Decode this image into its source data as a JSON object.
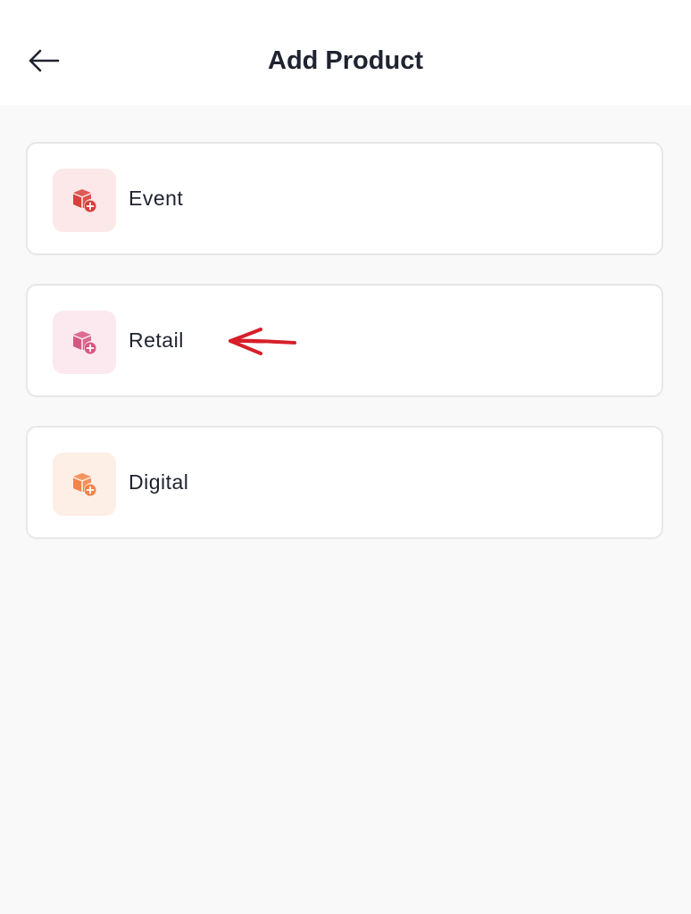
{
  "header": {
    "title": "Add Product",
    "back_icon": "arrow-left-icon"
  },
  "options": [
    {
      "label": "Event",
      "icon": "box-add-icon",
      "icon_color": "#d93f3c",
      "icon_bg": "#fce8e8"
    },
    {
      "label": "Retail",
      "icon": "box-add-icon",
      "icon_color": "#d65781",
      "icon_bg": "#fce9ef"
    },
    {
      "label": "Digital",
      "icon": "box-add-icon",
      "icon_color": "#f2844a",
      "icon_bg": "#fdeee6"
    }
  ],
  "annotation": {
    "icon": "red-arrow-icon",
    "color": "#d61f2a"
  }
}
